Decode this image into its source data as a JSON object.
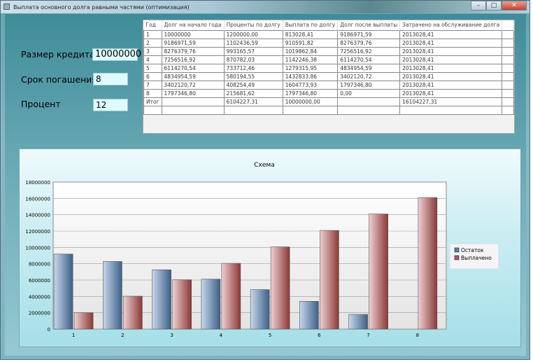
{
  "window": {
    "title": "Выплата основного долга равными частями (оптимизация)",
    "minimize": "–",
    "maximize": "□",
    "close": "✕"
  },
  "form": {
    "loan_label": "Размер кредита",
    "loan_value": "10000000",
    "term_label": "Срок погашения",
    "term_value": "8",
    "rate_label": "Процент",
    "rate_value": "12"
  },
  "table": {
    "headers": [
      "Год",
      "Долг на начало года",
      "Проценты по долгу",
      "Выплата по долгу",
      "Долг после выплаты",
      "Затрачено на обслуживание долга"
    ],
    "rows": [
      [
        "1",
        "10000000",
        "1200000,00",
        "813028,41",
        "9186971,59",
        "2013028,41"
      ],
      [
        "2",
        "9186971,59",
        "1102436,59",
        "910591,82",
        "8276379,76",
        "2013028,41"
      ],
      [
        "3",
        "8276379,76",
        "993165,57",
        "1019862,84",
        "7256516,92",
        "2013028,41"
      ],
      [
        "4",
        "7256516,92",
        "870782,03",
        "1142246,38",
        "6114270,54",
        "2013028,41"
      ],
      [
        "5",
        "6114270,54",
        "733712,46",
        "1279315,95",
        "4834954,59",
        "2013028,41"
      ],
      [
        "6",
        "4834954,59",
        "580194,55",
        "1432833,86",
        "3402120,72",
        "2013028,41"
      ],
      [
        "7",
        "3402120,72",
        "408254,49",
        "1604773,93",
        "1797346,80",
        "2013028,41"
      ],
      [
        "8",
        "1797346,80",
        "215681,62",
        "1797346,80",
        "0,00",
        "2013028,41"
      ],
      [
        "Итог",
        "",
        "6104227,31",
        "10000000,00",
        "",
        "16104227,31"
      ],
      [
        "",
        "",
        "",
        "",
        "",
        ""
      ]
    ]
  },
  "chart_data": {
    "type": "bar",
    "title": "Схема",
    "categories": [
      "1",
      "2",
      "3",
      "4",
      "5",
      "6",
      "7",
      "8"
    ],
    "series": [
      {
        "name": "Остаток",
        "color": "#5a7fa8",
        "values": [
          9186971.59,
          8276379.76,
          7256516.92,
          6114270.54,
          4834954.59,
          3402120.72,
          1797346.8,
          0
        ]
      },
      {
        "name": "Выплачено",
        "color": "#a85a5a",
        "values": [
          2013028.41,
          4026056.82,
          6039085.23,
          8052113.64,
          10065142.05,
          12078170.46,
          14091198.87,
          16104227.31
        ]
      }
    ],
    "ylim": [
      0,
      18000000
    ],
    "yticks": [
      "0",
      "2000000",
      "4000000",
      "6000000",
      "8000000",
      "10000000",
      "12000000",
      "14000000",
      "16000000",
      "18000000"
    ],
    "legend": "right"
  }
}
